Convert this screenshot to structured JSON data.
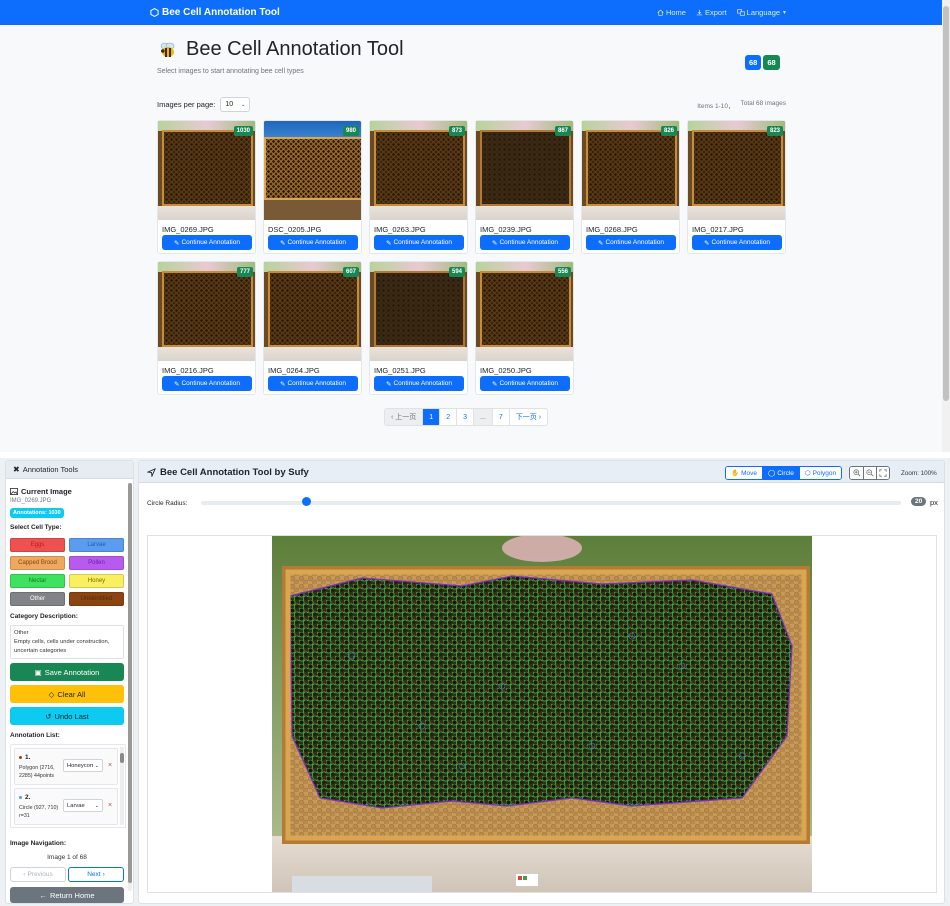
{
  "navbar": {
    "brand": "Bee Cell Annotation Tool",
    "links": [
      {
        "label": "Home",
        "icon": "home-icon"
      },
      {
        "label": "Export",
        "icon": "download-icon"
      },
      {
        "label": "Language",
        "icon": "language-icon"
      }
    ]
  },
  "page": {
    "title": "Bee Cell Annotation Tool",
    "subtitle": "Select images to start annotating bee cell types",
    "badge_a": "68",
    "badge_b": "68",
    "per_page_label": "Images per page:",
    "per_page_value": "10",
    "items_range": "Items 1-10，",
    "items_total": "Total 68 images",
    "card_button": "Continue Annotation"
  },
  "cards": [
    {
      "name": "IMG_0269.JPG",
      "count": "1030"
    },
    {
      "name": "DSC_0205.JPG",
      "count": "980"
    },
    {
      "name": "IMG_0263.JPG",
      "count": "873"
    },
    {
      "name": "IMG_0239.JPG",
      "count": "867"
    },
    {
      "name": "IMG_0268.JPG",
      "count": "826"
    },
    {
      "name": "IMG_0217.JPG",
      "count": "823"
    },
    {
      "name": "IMG_0216.JPG",
      "count": "777"
    },
    {
      "name": "IMG_0264.JPG",
      "count": "607"
    },
    {
      "name": "IMG_0251.JPG",
      "count": "594"
    },
    {
      "name": "IMG_0250.JPG",
      "count": "556"
    }
  ],
  "pagination": {
    "prev": "上一页",
    "pages": [
      "1",
      "2",
      "3",
      "...",
      "7"
    ],
    "next": "下一页",
    "current": "1"
  },
  "sidebar": {
    "header": "Annotation Tools",
    "current_image_title": "Current Image",
    "current_image_name": "IMG_0269.JPG",
    "annotation_count": "Annotations: 1030",
    "select_cell_type": "Select Cell Type:",
    "cell_types": [
      {
        "label": "Eggs",
        "color": "#f05050",
        "text": "#b02020"
      },
      {
        "label": "Larvae",
        "color": "#5a9cf0",
        "text": "#2a5ab0"
      },
      {
        "label": "Capped Brood",
        "color": "#f0a860",
        "text": "#7a4a10"
      },
      {
        "label": "Pollen",
        "color": "#b85af0",
        "text": "#6a1ab0"
      },
      {
        "label": "Nectar",
        "color": "#40e060",
        "text": "#107a20"
      },
      {
        "label": "Honey",
        "color": "#f8f060",
        "text": "#7a6a00"
      },
      {
        "label": "Other",
        "color": "#808488",
        "text": "#ffffff"
      },
      {
        "label": "Unidentified",
        "color": "#8b4513",
        "text": "#5a2a05"
      }
    ],
    "category_desc_title": "Category Description:",
    "category_name": "Other",
    "category_desc": "Empty cells, cells under construction, uncertain categories",
    "save": "Save Annotation",
    "clear": "Clear All",
    "undo": "Undo Last",
    "annotation_list_title": "Annotation List:",
    "annotations": [
      {
        "num": "1.",
        "desc": "Polygon (2716, 2285) 44points",
        "type": "Honeycomb",
        "dot": "#8b4513"
      },
      {
        "num": "2.",
        "desc": "Circle (927, 710) r=31",
        "type": "Larvae",
        "dot": "#5a9cf0"
      }
    ],
    "image_nav_title": "Image Navigation:",
    "image_counter": "Image 1 of 68",
    "prev": "Previous",
    "next": "Next",
    "return_home": "Return Home",
    "delete_symbol": "×"
  },
  "workspace": {
    "title": "Bee Cell Annotation Tool by Sufy",
    "modes": [
      {
        "label": "Move",
        "icon": "hand-icon"
      },
      {
        "label": "Circle",
        "icon": "circle-icon",
        "active": true
      },
      {
        "label": "Polygon",
        "icon": "polygon-icon"
      }
    ],
    "zoom_label": "Zoom: 100%",
    "radius_label": "Circle Radius:",
    "radius_value": "20",
    "radius_unit": "px",
    "radius_fraction": 0.15
  },
  "colors": {
    "primary": "#0d6efd",
    "success": "#198754",
    "warning": "#ffc107",
    "info": "#0dcaf0",
    "secondary": "#6c757d"
  }
}
